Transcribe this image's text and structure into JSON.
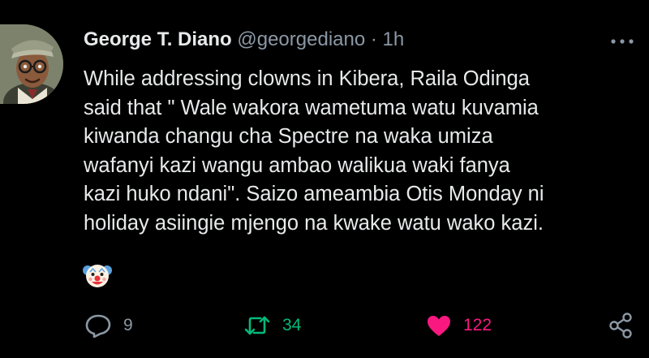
{
  "tweet": {
    "author": {
      "display_name": "George T. Diano",
      "handle": "@georgediano",
      "separator": "·",
      "time": "1h"
    },
    "text_lines": [
      "While addressing clowns in Kibera, Raila Odinga",
      "said that \" Wale wakora wametuma watu kuvamia",
      "kiwanda changu cha Spectre na waka umiza",
      "wafanyi kazi wangu ambao walikua waki fanya",
      "kazi huko ndani\". Saizo ameambia Otis Monday ni",
      "holiday asiingie mjengo na kwake watu wako kazi."
    ],
    "emoji": "clown-face",
    "actions": {
      "replies": "9",
      "retweets": "34",
      "likes": "122"
    }
  },
  "colors": {
    "background": "#000000",
    "text": "#e7e9ea",
    "secondary": "#8b98a5",
    "retweet_green": "#00ba7c",
    "like_pink": "#f91880"
  }
}
